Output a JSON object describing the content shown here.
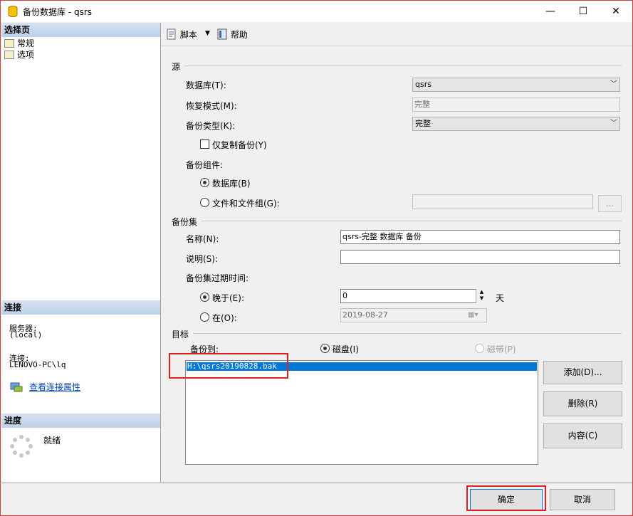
{
  "window": {
    "title": "备份数据库 - qsrs",
    "minimize": "—",
    "maximize": "☐",
    "close": "✕"
  },
  "left": {
    "select_page_header": "选择页",
    "pages": [
      {
        "label": "常规"
      },
      {
        "label": "选项"
      }
    ],
    "connection_header": "连接",
    "server_label": "服务器:",
    "server_value": "(local)",
    "connection_label": "连接:",
    "connection_value": "LENOVO-PC\\lq",
    "view_props_link": "查看连接属性",
    "progress_header": "进度",
    "progress_status": "就绪"
  },
  "toolbar": {
    "script_label": "脚本",
    "help_label": "帮助"
  },
  "source": {
    "group_label": "源",
    "database_label": "数据库(T):",
    "database_value": "qsrs",
    "recovery_label": "恢复模式(M):",
    "recovery_value": "完整",
    "backup_type_label": "备份类型(K):",
    "backup_type_value": "完整",
    "copy_only_label": "仅复制备份(Y)",
    "copy_only_checked": false,
    "component_label": "备份组件:",
    "component_database_label": "数据库(B)",
    "component_files_label": "文件和文件组(G):",
    "files_value": "",
    "files_browse": "..."
  },
  "backup_set": {
    "group_label": "备份集",
    "name_label": "名称(N):",
    "name_value": "qsrs-完整 数据库 备份",
    "desc_label": "说明(S):",
    "desc_value": "",
    "expire_label": "备份集过期时间:",
    "after_label": "晚于(E):",
    "after_value": "0",
    "days_label": "天",
    "on_label": "在(O):",
    "on_value": "2019-08-27"
  },
  "destination": {
    "group_label": "目标",
    "backup_to_label": "备份到:",
    "disk_label": "磁盘(I)",
    "tape_label": "磁带(P)",
    "files": [
      "H:\\qsrs20190828.bak"
    ],
    "add_button": "添加(D)...",
    "remove_button": "删除(R)",
    "contents_button": "内容(C)"
  },
  "footer": {
    "ok_button": "确定",
    "cancel_button": "取消"
  },
  "colors": {
    "highlight": "#0078d7",
    "annotation_red": "#e02020",
    "link": "#0645ad"
  }
}
